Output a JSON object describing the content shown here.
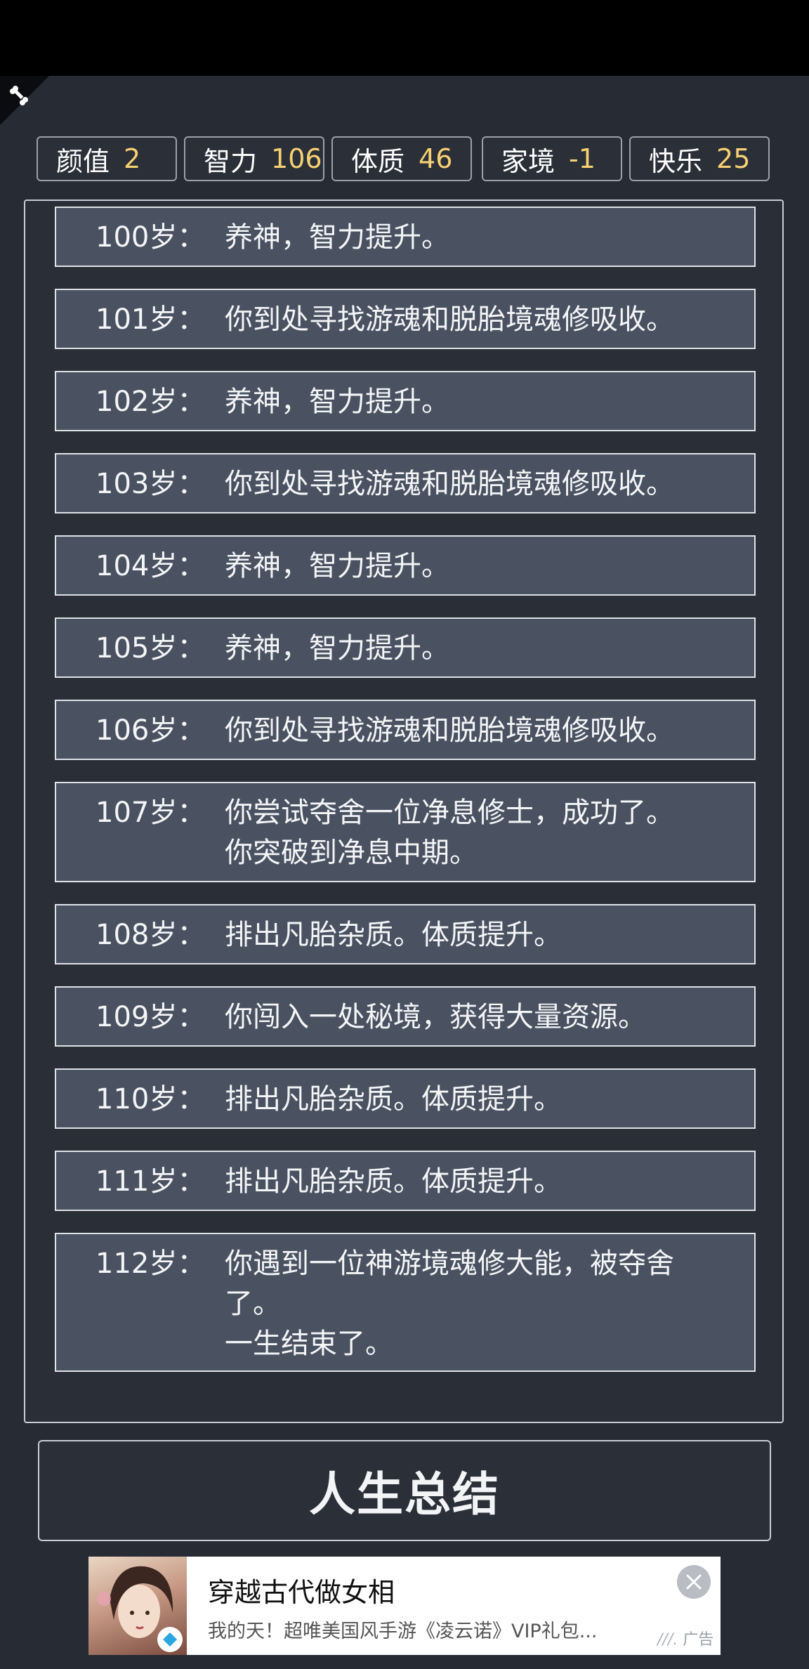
{
  "stats": [
    {
      "label": "颜值",
      "value": "2"
    },
    {
      "label": "智力",
      "value": "106"
    },
    {
      "label": "体质",
      "value": "46"
    },
    {
      "label": "家境",
      "value": "-1"
    },
    {
      "label": "快乐",
      "value": "25"
    }
  ],
  "log": [
    {
      "age": "100岁：",
      "lines": [
        "养神，智力提升。"
      ]
    },
    {
      "age": "101岁：",
      "lines": [
        "你到处寻找游魂和脱胎境魂修吸收。"
      ]
    },
    {
      "age": "102岁：",
      "lines": [
        "养神，智力提升。"
      ]
    },
    {
      "age": "103岁：",
      "lines": [
        "你到处寻找游魂和脱胎境魂修吸收。"
      ]
    },
    {
      "age": "104岁：",
      "lines": [
        "养神，智力提升。"
      ]
    },
    {
      "age": "105岁：",
      "lines": [
        "养神，智力提升。"
      ]
    },
    {
      "age": "106岁：",
      "lines": [
        "你到处寻找游魂和脱胎境魂修吸收。"
      ]
    },
    {
      "age": "107岁：",
      "lines": [
        "你尝试夺舍一位净息修士，成功了。",
        "你突破到净息中期。"
      ]
    },
    {
      "age": "108岁：",
      "lines": [
        "排出凡胎杂质。体质提升。"
      ]
    },
    {
      "age": "109岁：",
      "lines": [
        "你闯入一处秘境，获得大量资源。"
      ]
    },
    {
      "age": "110岁：",
      "lines": [
        "排出凡胎杂质。体质提升。"
      ]
    },
    {
      "age": "111岁：",
      "lines": [
        "排出凡胎杂质。体质提升。"
      ]
    },
    {
      "age": "112岁：",
      "lines": [
        "你遇到一位神游境魂修大能，被夺舍",
        "了。",
        "一生结束了。"
      ]
    }
  ],
  "summary_button": {
    "label": "人生总结"
  },
  "ad": {
    "title": "穿越古代做女相",
    "description": "我的天！超唯美国风手游《凌云诺》VIP礼包...",
    "tag": "广告"
  },
  "colors": {
    "stat_value": "#f6d173",
    "entry_bg": "#4a5261",
    "page_bg": "#272b34"
  }
}
